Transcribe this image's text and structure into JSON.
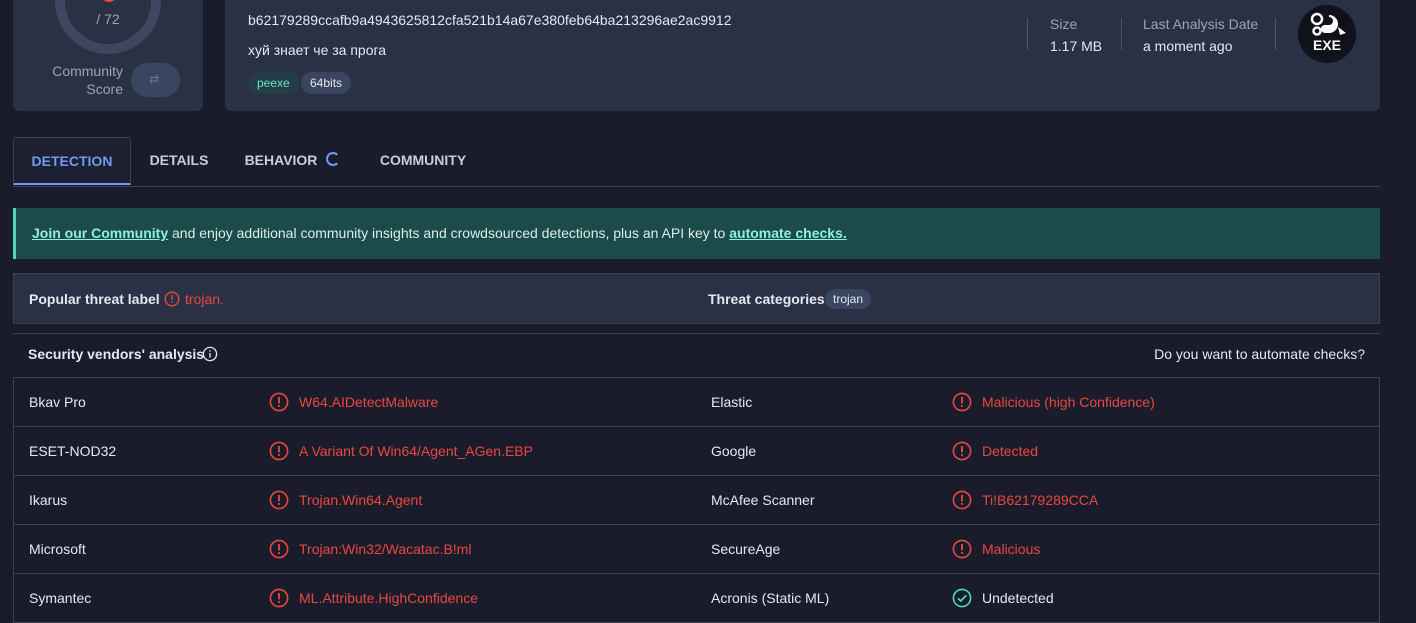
{
  "score": {
    "ratio": "/ 72",
    "community_label_1": "Community",
    "community_label_2": "Score",
    "toggle_glyph": "⇄"
  },
  "file": {
    "hash": "b62179289ccafb9a4943625812cfa521b14a67e380feb64ba213296ae2ac9912",
    "name": "хуй знает че за прога",
    "tags": [
      "peexe",
      "64bits"
    ],
    "size_label": "Size",
    "size_value": "1.17 MB",
    "date_label": "Last Analysis Date",
    "date_value": "a moment ago",
    "type_badge": "EXE"
  },
  "tabs": [
    {
      "label": "DETECTION",
      "active": true
    },
    {
      "label": "DETAILS",
      "active": false
    },
    {
      "label": "BEHAVIOR",
      "active": false
    },
    {
      "label": "COMMUNITY",
      "active": false
    }
  ],
  "banner": {
    "link1": "Join our Community",
    "text": " and enjoy additional community insights and crowdsourced detections, plus an API key to ",
    "link2": "automate checks."
  },
  "threat": {
    "label_title": "Popular threat label",
    "label_value": "trojan.",
    "categories_title": "Threat categories",
    "categories": [
      "trojan"
    ]
  },
  "vendors": {
    "title": "Security vendors' analysis",
    "automate_prompt": "Do you want to automate checks?",
    "rows": [
      {
        "left": {
          "vendor": "Bkav Pro",
          "result": "W64.AIDetectMalware",
          "status": "malicious"
        },
        "right": {
          "vendor": "Elastic",
          "result": "Malicious (high Confidence)",
          "status": "malicious"
        }
      },
      {
        "left": {
          "vendor": "ESET-NOD32",
          "result": "A Variant Of Win64/Agent_AGen.EBP",
          "status": "malicious"
        },
        "right": {
          "vendor": "Google",
          "result": "Detected",
          "status": "malicious"
        }
      },
      {
        "left": {
          "vendor": "Ikarus",
          "result": "Trojan.Win64.Agent",
          "status": "malicious"
        },
        "right": {
          "vendor": "McAfee Scanner",
          "result": "Ti!B62179289CCA",
          "status": "malicious"
        }
      },
      {
        "left": {
          "vendor": "Microsoft",
          "result": "Trojan:Win32/Wacatac.B!ml",
          "status": "malicious"
        },
        "right": {
          "vendor": "SecureAge",
          "result": "Malicious",
          "status": "malicious"
        }
      },
      {
        "left": {
          "vendor": "Symantec",
          "result": "ML.Attribute.HighConfidence",
          "status": "malicious"
        },
        "right": {
          "vendor": "Acronis (Static ML)",
          "result": "Undetected",
          "status": "undetected"
        }
      }
    ]
  },
  "colors": {
    "malicious": "#e8483f",
    "undetected": "#4fd6c3",
    "accent": "#6e9bf5"
  }
}
